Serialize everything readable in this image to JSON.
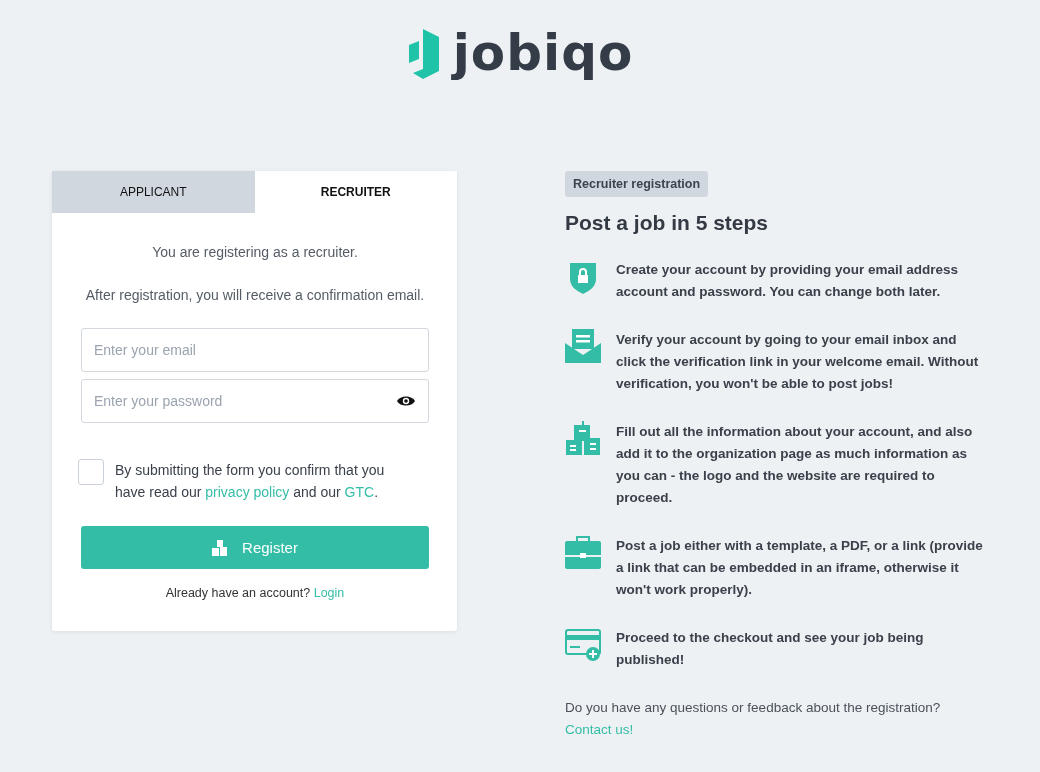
{
  "logo": {
    "text": "jobiqo"
  },
  "tabs": [
    {
      "label": "APPLICANT",
      "selected": false
    },
    {
      "label": "RECRUITER",
      "selected": true
    }
  ],
  "form": {
    "intro": "You are registering as a recruiter.",
    "note": "After registration, you will receive a confirmation email.",
    "email": {
      "placeholder": "Enter your email"
    },
    "password": {
      "placeholder": "Enter your password"
    },
    "consent": {
      "checked": false,
      "before": "By submitting the form you confirm that you have read our ",
      "privacy_link": "privacy policy",
      "middle": " and our ",
      "gtc_link": "GTC",
      "end": "."
    },
    "submit": "Register",
    "login_prompt": "Already have an account?",
    "login_link": "Login"
  },
  "info": {
    "badge": "Recruiter registration",
    "heading": "Post a job in 5 steps",
    "steps": [
      {
        "kind": "shield",
        "text": "Create your account by providing your email address account and password. You can change both later."
      },
      {
        "kind": "envelope",
        "text": "Verify your account by going to your email inbox and click the verification link in your welcome email. Without verification, you won't be able to post jobs!"
      },
      {
        "kind": "buildings",
        "text": "Fill out all the information about your account, and also add it to the organization page as much information as you can - the logo and the website are required to proceed."
      },
      {
        "kind": "briefcase",
        "text": "Post a job either with a template, a PDF, or a link (provide a link that can be embedded in an iframe, otherwise it won't work properly)."
      },
      {
        "kind": "card",
        "text": "Proceed to the checkout and see your job being published!"
      }
    ],
    "question": "Do you have any questions or feedback about the registration?",
    "contact_link": "Contact us!"
  }
}
